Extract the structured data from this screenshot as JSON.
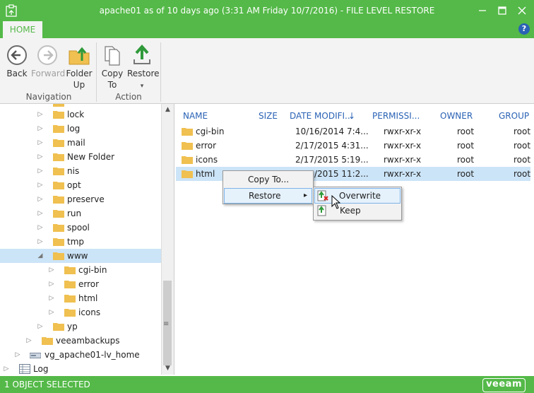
{
  "window": {
    "title": "apache01 as of 10 days ago (3:31 AM Friday 10/7/2016) - FILE LEVEL RESTORE",
    "controls": [
      "minimize",
      "maximize",
      "close"
    ]
  },
  "ribbon": {
    "tab": "HOME",
    "help": "?",
    "buttons": {
      "back": "Back",
      "forward": "Forward",
      "folder_up_1": "Folder",
      "folder_up_2": "Up",
      "copy_to_1": "Copy",
      "copy_to_2": "To",
      "restore": "Restore",
      "restore_arrow": "▾"
    },
    "groups": {
      "navigation": "Navigation",
      "action": "Action"
    }
  },
  "tree": {
    "items": [
      {
        "label": "lock",
        "expander": "▷"
      },
      {
        "label": "log",
        "expander": "▷"
      },
      {
        "label": "mail",
        "expander": "▷"
      },
      {
        "label": "New Folder",
        "expander": "▷"
      },
      {
        "label": "nis",
        "expander": "▷"
      },
      {
        "label": "opt",
        "expander": "▷"
      },
      {
        "label": "preserve",
        "expander": "▷"
      },
      {
        "label": "run",
        "expander": "▷"
      },
      {
        "label": "spool",
        "expander": "▷"
      },
      {
        "label": "tmp",
        "expander": "▷"
      },
      {
        "label": "www",
        "expander": "◢"
      },
      {
        "label": "cgi-bin",
        "expander": "▷"
      },
      {
        "label": "error",
        "expander": "▷"
      },
      {
        "label": "html",
        "expander": "▷"
      },
      {
        "label": "icons",
        "expander": "▷"
      },
      {
        "label": "yp",
        "expander": "▷"
      },
      {
        "label": "veeambackups",
        "expander": "▷"
      },
      {
        "label": "vg_apache01-lv_home",
        "expander": "▷"
      },
      {
        "label": "Log",
        "expander": "▷"
      }
    ]
  },
  "file_list": {
    "columns": {
      "name": "NAME",
      "size": "SIZE",
      "date": "DATE MODIFI...",
      "sort_icon": "↓",
      "permissions": "PERMISSI...",
      "owner": "OWNER",
      "group": "GROUP"
    },
    "rows": [
      {
        "name": "cgi-bin",
        "size": "",
        "date": "10/16/2014 7:4...",
        "permissions": "rwxr-xr-x",
        "owner": "root",
        "group": "root"
      },
      {
        "name": "error",
        "size": "",
        "date": "2/17/2015 4:31...",
        "permissions": "rwxr-xr-x",
        "owner": "root",
        "group": "root"
      },
      {
        "name": "icons",
        "size": "",
        "date": "2/17/2015 5:19...",
        "permissions": "rwxr-xr-x",
        "owner": "root",
        "group": "root"
      },
      {
        "name": "html",
        "size": "",
        "date": "2/17/2015 11:2...",
        "permissions": "rwxr-xr-x",
        "owner": "root",
        "group": "root"
      }
    ]
  },
  "context_menu": {
    "items": [
      {
        "label": "Copy To..."
      },
      {
        "label": "Restore",
        "arrow": "▸"
      }
    ],
    "submenu": [
      {
        "label": "Overwrite"
      },
      {
        "label": "Keep"
      }
    ]
  },
  "status": {
    "text": "1 OBJECT SELECTED",
    "logo": "veeam"
  },
  "colors": {
    "brand_green": "#54b948",
    "accent_blue": "#2a62b5",
    "selection": "#cce4f7",
    "folder": "#f0c050"
  }
}
